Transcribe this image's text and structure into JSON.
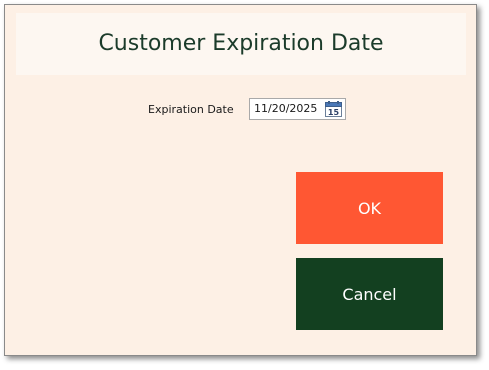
{
  "dialog": {
    "title": "Customer Expiration Date"
  },
  "form": {
    "expiration_label": "Expiration Date",
    "expiration_value": "11/20/2025",
    "calendar_icon": "calendar-icon",
    "calendar_day": "15"
  },
  "buttons": {
    "ok_label": "OK",
    "cancel_label": "Cancel"
  },
  "colors": {
    "background": "#fdf0e5",
    "header_panel": "#fdf7f1",
    "title_text": "#1b3b2a",
    "ok_button": "#ff5733",
    "cancel_button": "#134020"
  }
}
